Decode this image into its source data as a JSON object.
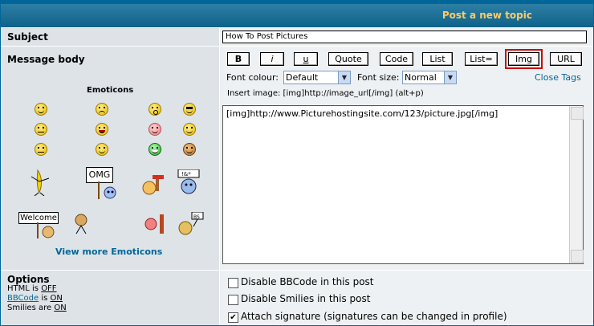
{
  "header": {
    "title": "Post a new topic"
  },
  "subject": {
    "label": "Subject",
    "value": "How To Post Pictures"
  },
  "message": {
    "label": "Message body"
  },
  "toolbar": {
    "buttons": [
      {
        "label": "B"
      },
      {
        "label": "i"
      },
      {
        "label": "u"
      },
      {
        "label": "Quote"
      },
      {
        "label": "Code"
      },
      {
        "label": "List"
      },
      {
        "label": "List="
      },
      {
        "label": "Img"
      },
      {
        "label": "URL"
      }
    ],
    "font_colour_label": "Font colour:",
    "font_colour_value": "Default",
    "font_size_label": "Font size:",
    "font_size_value": "Normal",
    "close_tags": "Close Tags",
    "helpline": "Insert image: [img]http://image_url[/img]  (alt+p)"
  },
  "body_text": "[img]http://www.Picturehostingsite.com/123/picture.jpg[/img]",
  "emoticons": {
    "title": "Emoticons",
    "sign_omg": "OMG",
    "sign_welcome": "Welcome",
    "view_more": "View more Emoticons"
  },
  "options": {
    "title": "Options",
    "html_label": "HTML is",
    "html_value": "OFF",
    "bbcode_link": "BBCode",
    "bbcode_is": "is",
    "bbcode_value": "ON",
    "smilies_label": "Smilies are",
    "smilies_value": "ON",
    "checkboxes": [
      {
        "label": "Disable BBCode in this post",
        "checked": false
      },
      {
        "label": "Disable Smilies in this post",
        "checked": false
      },
      {
        "label": "Attach signature (signatures can be changed in profile)",
        "checked": true
      }
    ]
  }
}
